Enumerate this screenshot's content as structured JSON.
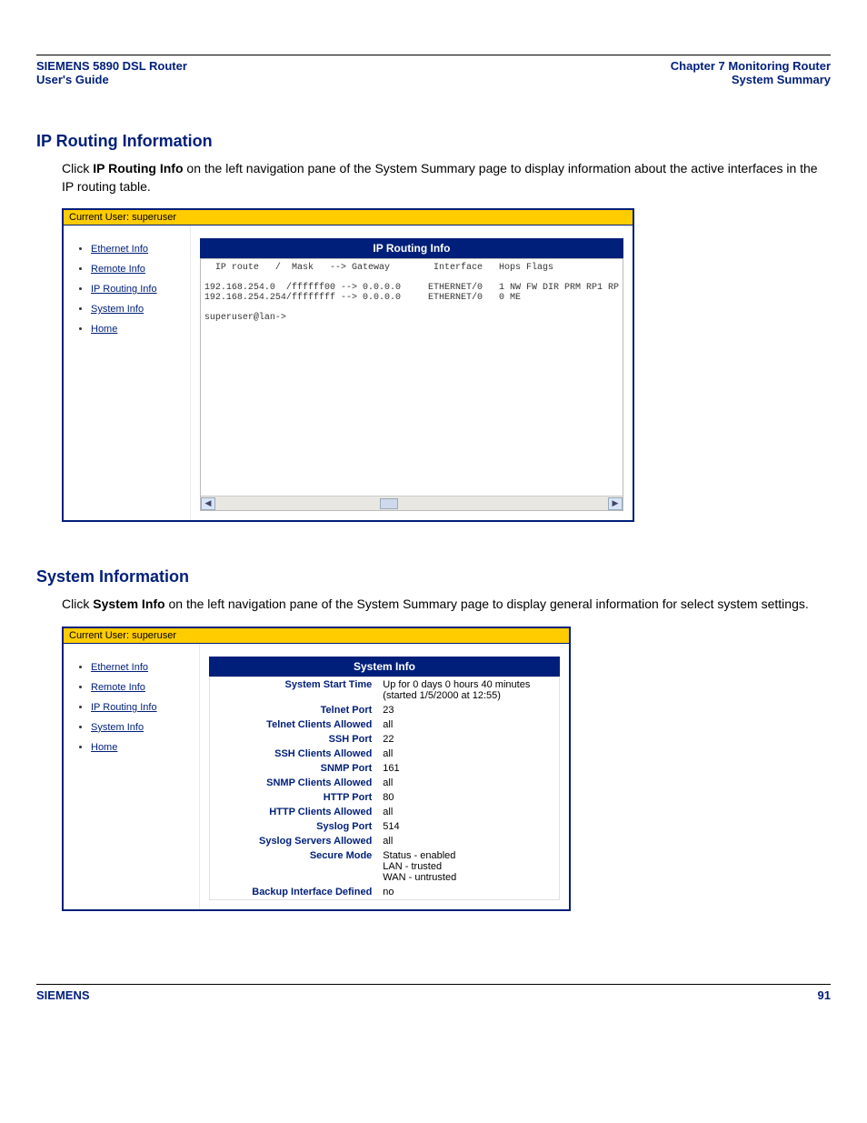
{
  "header": {
    "left_line1": "SIEMENS 5890 DSL Router",
    "left_line2": "User's Guide",
    "right_line1": "Chapter 7  Monitoring Router",
    "right_line2": "System Summary"
  },
  "section1": {
    "title": "IP Routing Information",
    "para_pre": "Click ",
    "para_bold": "IP Routing Info",
    "para_post": " on the left navigation pane of the System Summary page to display information about the active interfaces in the IP routing table."
  },
  "screenshot1": {
    "user_label": "Current User: superuser",
    "nav": [
      "Ethernet Info",
      "Remote Info",
      "IP Routing Info",
      "System Info",
      "Home"
    ],
    "panel_title": "IP Routing Info",
    "console": "  IP route   /  Mask   --> Gateway        Interface   Hops Flags\n\n192.168.254.0  /ffffff00 --> 0.0.0.0     ETHERNET/0   1 NW FW DIR PRM RP1 RP\n192.168.254.254/ffffffff --> 0.0.0.0     ETHERNET/0   0 ME\n\nsuperuser@lan->"
  },
  "section2": {
    "title": "System Information",
    "para_pre": "Click ",
    "para_bold": "System Info",
    "para_post": " on the left navigation pane of the System Summary page to display general information for select system settings."
  },
  "screenshot2": {
    "user_label": "Current User: superuser",
    "nav": [
      "Ethernet Info",
      "Remote Info",
      "IP Routing Info",
      "System Info",
      "Home"
    ],
    "panel_title": "System Info",
    "rows": [
      {
        "label": "System Start Time",
        "value": "Up for 0 days 0 hours 40 minutes (started 1/5/2000 at 12:55)"
      },
      {
        "label": "Telnet Port",
        "value": "23"
      },
      {
        "label": "Telnet Clients Allowed",
        "value": "all"
      },
      {
        "label": "SSH Port",
        "value": "22"
      },
      {
        "label": "SSH Clients Allowed",
        "value": "all"
      },
      {
        "label": "SNMP Port",
        "value": "161"
      },
      {
        "label": "SNMP Clients Allowed",
        "value": "all"
      },
      {
        "label": "HTTP Port",
        "value": "80"
      },
      {
        "label": "HTTP Clients Allowed",
        "value": "all"
      },
      {
        "label": "Syslog Port",
        "value": "514"
      },
      {
        "label": "Syslog Servers Allowed",
        "value": "all"
      },
      {
        "label": "Secure Mode",
        "value": "Status - enabled\nLAN - trusted\nWAN - untrusted"
      },
      {
        "label": "Backup Interface Defined",
        "value": "no"
      }
    ]
  },
  "footer": {
    "brand": "SIEMENS",
    "page": "91"
  }
}
